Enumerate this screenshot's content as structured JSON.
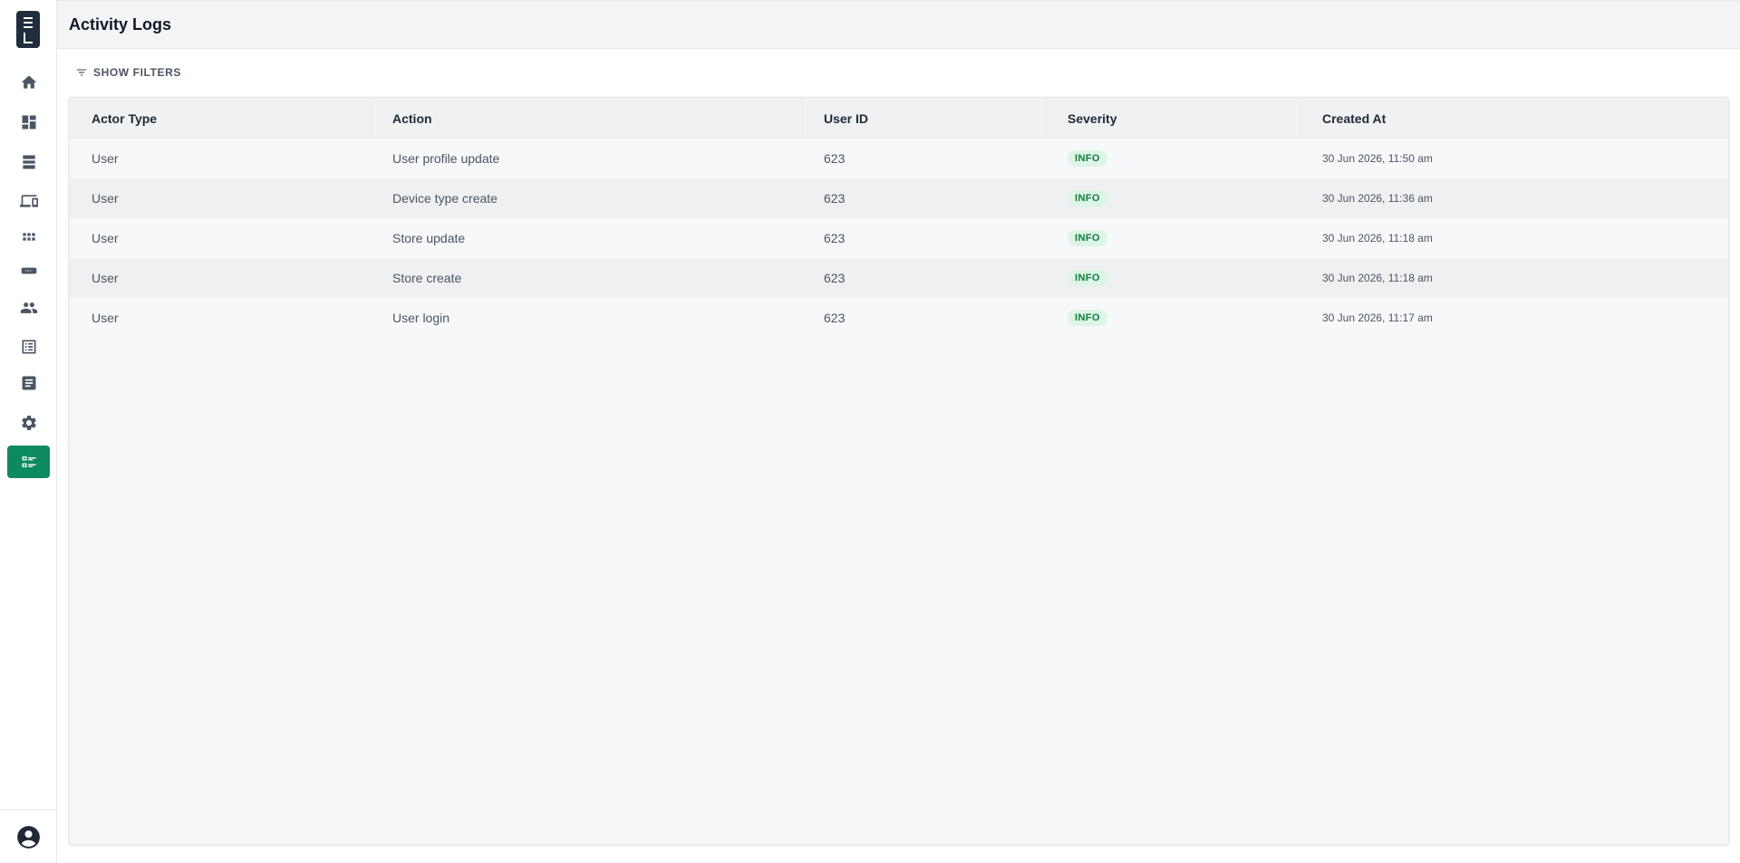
{
  "page": {
    "title": "Activity Logs"
  },
  "sidebar": {
    "items": [
      {
        "name": "home",
        "icon": "home-icon",
        "active": false
      },
      {
        "name": "dashboard",
        "icon": "dashboard-icon",
        "active": false
      },
      {
        "name": "storage",
        "icon": "storage-icon",
        "active": false
      },
      {
        "name": "devices",
        "icon": "devices-icon",
        "active": false
      },
      {
        "name": "apps",
        "icon": "apps-icon",
        "active": false
      },
      {
        "name": "hardware",
        "icon": "hardware-icon",
        "active": false
      },
      {
        "name": "users",
        "icon": "people-icon",
        "active": false
      },
      {
        "name": "list",
        "icon": "list-icon",
        "active": false
      },
      {
        "name": "documents",
        "icon": "document-icon",
        "active": false
      },
      {
        "name": "settings",
        "icon": "gear-icon",
        "active": false
      },
      {
        "name": "activity-logs",
        "icon": "activity-list-icon",
        "active": true
      }
    ],
    "accent_color": "#0e8a63"
  },
  "filters": {
    "label": "SHOW FILTERS"
  },
  "table": {
    "columns": [
      "Actor Type",
      "Action",
      "User ID",
      "Severity",
      "Created At"
    ],
    "rows": [
      {
        "actor_type": "User",
        "action": "User profile update",
        "user_id": "623",
        "severity": "INFO",
        "created_at": "30 Jun 2026, 11:50 am"
      },
      {
        "actor_type": "User",
        "action": "Device type create",
        "user_id": "623",
        "severity": "INFO",
        "created_at": "30 Jun 2026, 11:36 am"
      },
      {
        "actor_type": "User",
        "action": "Store update",
        "user_id": "623",
        "severity": "INFO",
        "created_at": "30 Jun 2026, 11:18 am"
      },
      {
        "actor_type": "User",
        "action": "Store create",
        "user_id": "623",
        "severity": "INFO",
        "created_at": "30 Jun 2026, 11:18 am"
      },
      {
        "actor_type": "User",
        "action": "User login",
        "user_id": "623",
        "severity": "INFO",
        "created_at": "30 Jun 2026, 11:17 am"
      }
    ],
    "severity_colors": {
      "INFO": "#157a3c"
    }
  }
}
